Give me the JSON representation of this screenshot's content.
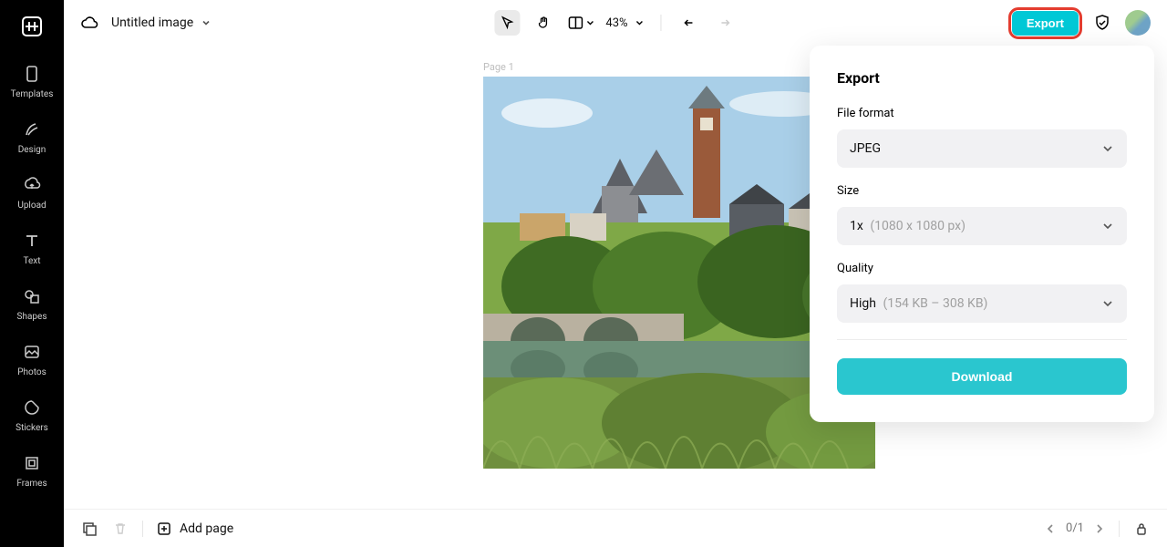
{
  "sidebar": {
    "items": [
      {
        "label": "Templates"
      },
      {
        "label": "Design"
      },
      {
        "label": "Upload"
      },
      {
        "label": "Text"
      },
      {
        "label": "Shapes"
      },
      {
        "label": "Photos"
      },
      {
        "label": "Stickers"
      },
      {
        "label": "Frames"
      }
    ]
  },
  "topbar": {
    "title": "Untitled image",
    "zoom": "43%",
    "export_label": "Export"
  },
  "canvas": {
    "page_label": "Page 1"
  },
  "export": {
    "title": "Export",
    "fileformat_label": "File format",
    "fileformat_value": "JPEG",
    "size_label": "Size",
    "size_value": "1x",
    "size_detail": "(1080 x 1080 px)",
    "quality_label": "Quality",
    "quality_value": "High",
    "quality_detail": "(154 KB – 308 KB)",
    "download_label": "Download"
  },
  "bottombar": {
    "addpage": "Add page",
    "pager": "0/1"
  }
}
